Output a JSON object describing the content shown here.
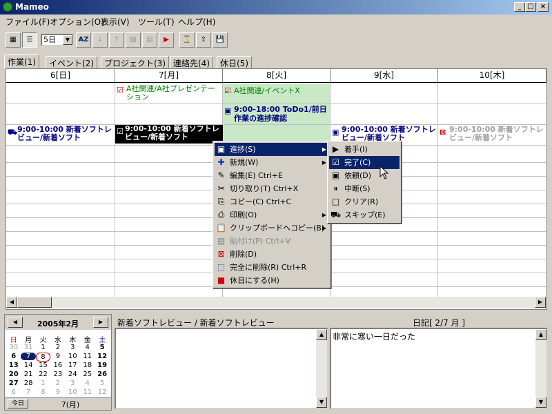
{
  "window": {
    "title": "Mameo"
  },
  "menu": [
    "ファイル(F)",
    "オプション(O)",
    "表示(V)",
    "ツール(T)",
    "ヘルプ(H)"
  ],
  "toolbar": {
    "combo_value": "5日"
  },
  "tabs": [
    "作業(1)",
    "イベント(2)",
    "プロジェクト(3)",
    "連絡先(4)",
    "休日(5)"
  ],
  "calendar": {
    "days": [
      "6[日]",
      "7[月]",
      "8[火]",
      "9[水]",
      "10[木]"
    ],
    "events": {
      "e1": "A社関連/A社プレゼンテーション",
      "e2": "A社関連/イベントX",
      "e3": "9:00-18:00 ToDo1/前日作業の進捗確認",
      "e4": "9:00-10:00 新着ソフトレビュー/新着ソフト",
      "e5": "9:00-10:00 新着ソフトレビュー/新着ソフト",
      "e6": "9:00-10:00 新着ソフトレビュー/新着ソフト",
      "e7": "9:00-10:00 新着ソフトレビュー/新着ソフト",
      "e8": "9:00-10:00 新着ソフトレビュー/新着ソフト"
    }
  },
  "context_menu": [
    {
      "label": "進捗(S)",
      "shortcut": ""
    },
    {
      "label": "新規(W)",
      "shortcut": ""
    },
    {
      "label": "編集(E)",
      "shortcut": "Ctrl+E"
    },
    {
      "label": "切り取り(T)",
      "shortcut": "Ctrl+X"
    },
    {
      "label": "コピー(C)",
      "shortcut": "Ctrl+C"
    },
    {
      "label": "印刷(O)",
      "shortcut": ""
    },
    {
      "label": "クリップボードへコピー(B)",
      "shortcut": ""
    },
    {
      "label": "貼付け(P)",
      "shortcut": "Ctrl+V"
    },
    {
      "label": "削除(D)",
      "shortcut": ""
    },
    {
      "label": "完全に削除(R)",
      "shortcut": "Ctrl+R"
    },
    {
      "label": "休日にする(H)",
      "shortcut": ""
    }
  ],
  "submenu": [
    "着手(I)",
    "完了(C)",
    "依頼(D)",
    "中断(S)",
    "クリア(R)",
    "スキップ(E)"
  ],
  "mini_calendar": {
    "title": "2005年2月",
    "weekdays": [
      "日",
      "月",
      "火",
      "水",
      "木",
      "金",
      "土"
    ],
    "rows": [
      [
        "30",
        "31",
        "1",
        "2",
        "3",
        "4",
        "5"
      ],
      [
        "6",
        "7",
        "8",
        "9",
        "10",
        "11",
        "12"
      ],
      [
        "13",
        "14",
        "15",
        "16",
        "17",
        "18",
        "19"
      ],
      [
        "20",
        "21",
        "22",
        "23",
        "24",
        "25",
        "26"
      ],
      [
        "27",
        "28",
        "1",
        "2",
        "3",
        "4",
        "5"
      ],
      [
        "6",
        "7",
        "8",
        "9",
        "10",
        "11",
        "12"
      ]
    ],
    "today_button": "今日",
    "footer_date": "7(月)"
  },
  "memo": {
    "title": "新着ソフトレビュー / 新着ソフトレビュー",
    "text": ""
  },
  "diary": {
    "title": "日記[ 2/7 月 ]",
    "text": "非常に寒い一日だった"
  },
  "colors": {
    "highlight": "#0a246a",
    "event_green": "#008000",
    "todo_blue": "#000080"
  }
}
